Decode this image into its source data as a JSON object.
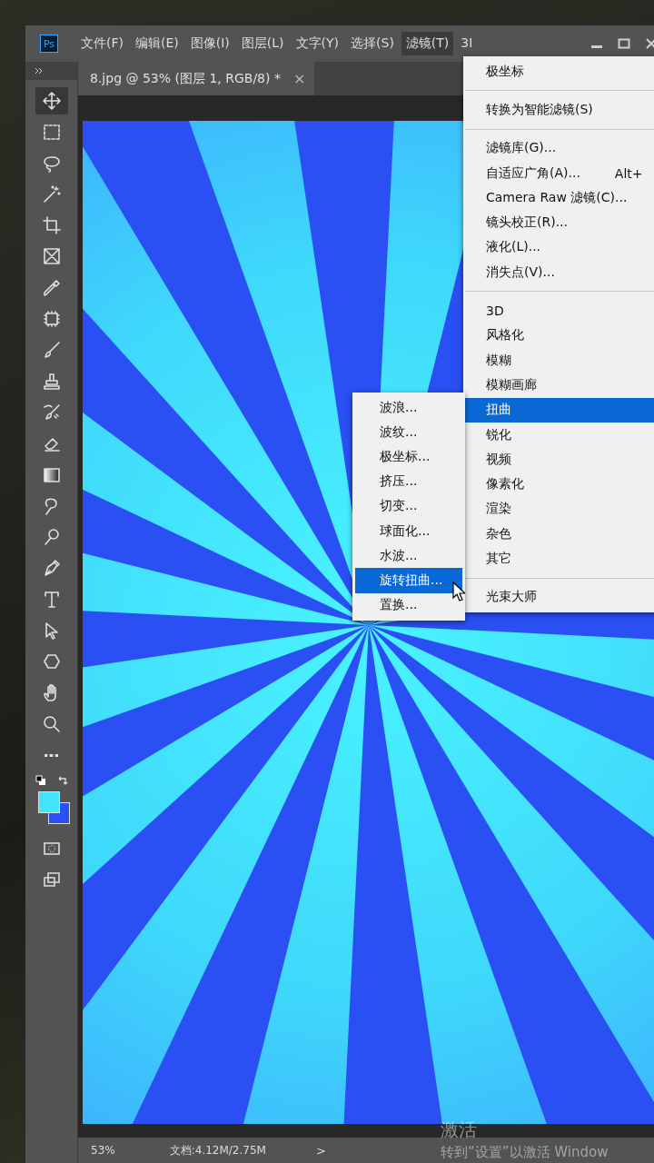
{
  "app": {
    "logo": "Ps"
  },
  "menubar": [
    {
      "label": "文件(F)",
      "selected": false
    },
    {
      "label": "编辑(E)",
      "selected": false
    },
    {
      "label": "图像(I)",
      "selected": false
    },
    {
      "label": "图层(L)",
      "selected": false
    },
    {
      "label": "文字(Y)",
      "selected": false
    },
    {
      "label": "选择(S)",
      "selected": false
    },
    {
      "label": "滤镜(T)",
      "selected": true
    },
    {
      "label": "3I",
      "selected": false
    }
  ],
  "document_tab": {
    "title": "8.jpg @ 53% (图层 1, RGB/8) *",
    "close": "×"
  },
  "tools": [
    {
      "kind": "move",
      "selected": true
    },
    {
      "kind": "marquee",
      "selected": false
    },
    {
      "kind": "lasso",
      "selected": false
    },
    {
      "kind": "wand",
      "selected": false
    },
    {
      "kind": "crop",
      "selected": false
    },
    {
      "kind": "frame",
      "selected": false
    },
    {
      "kind": "eyedropper",
      "selected": false
    },
    {
      "kind": "healing",
      "selected": false
    },
    {
      "kind": "brush",
      "selected": false
    },
    {
      "kind": "stamp",
      "selected": false
    },
    {
      "kind": "history",
      "selected": false
    },
    {
      "kind": "eraser",
      "selected": false
    },
    {
      "kind": "gradient",
      "selected": false
    },
    {
      "kind": "smudge",
      "selected": false
    },
    {
      "kind": "dodge",
      "selected": false
    },
    {
      "kind": "pen",
      "selected": false
    },
    {
      "kind": "type",
      "selected": false
    },
    {
      "kind": "pointer",
      "selected": false
    },
    {
      "kind": "shape",
      "selected": false
    },
    {
      "kind": "hand",
      "selected": false
    },
    {
      "kind": "zoom",
      "selected": false
    },
    {
      "kind": "more",
      "selected": false
    }
  ],
  "filter_menu": [
    {
      "kind": "item",
      "label": "极坐标",
      "selected": false
    },
    {
      "kind": "separator"
    },
    {
      "kind": "item",
      "label": "转换为智能滤镜(S)",
      "selected": false
    },
    {
      "kind": "separator"
    },
    {
      "kind": "item",
      "label": "滤镜库(G)...",
      "selected": false
    },
    {
      "kind": "item",
      "label": "自适应广角(A)...",
      "shortcut": "Alt+",
      "selected": false
    },
    {
      "kind": "item",
      "label": "Camera Raw 滤镜(C)...",
      "selected": false
    },
    {
      "kind": "item",
      "label": "镜头校正(R)...",
      "selected": false
    },
    {
      "kind": "item",
      "label": "液化(L)...",
      "selected": false
    },
    {
      "kind": "item",
      "label": "消失点(V)...",
      "selected": false
    },
    {
      "kind": "separator"
    },
    {
      "kind": "item",
      "label": "3D",
      "selected": false
    },
    {
      "kind": "item",
      "label": "风格化",
      "selected": false
    },
    {
      "kind": "item",
      "label": "模糊",
      "selected": false
    },
    {
      "kind": "item",
      "label": "模糊画廊",
      "selected": false
    },
    {
      "kind": "item",
      "label": "扭曲",
      "selected": true
    },
    {
      "kind": "item",
      "label": "锐化",
      "selected": false
    },
    {
      "kind": "item",
      "label": "视频",
      "selected": false
    },
    {
      "kind": "item",
      "label": "像素化",
      "selected": false
    },
    {
      "kind": "item",
      "label": "渲染",
      "selected": false
    },
    {
      "kind": "item",
      "label": "杂色",
      "selected": false
    },
    {
      "kind": "item",
      "label": "其它",
      "selected": false
    },
    {
      "kind": "separator"
    },
    {
      "kind": "item",
      "label": "光束大师",
      "selected": false
    }
  ],
  "distort_submenu": [
    {
      "label": "波浪...",
      "selected": false
    },
    {
      "label": "波纹...",
      "selected": false
    },
    {
      "label": "极坐标...",
      "selected": false
    },
    {
      "label": "挤压...",
      "selected": false
    },
    {
      "label": "切变...",
      "selected": false
    },
    {
      "label": "球面化...",
      "selected": false
    },
    {
      "label": "水波...",
      "selected": false
    },
    {
      "label": "旋转扭曲...",
      "selected": true
    },
    {
      "label": "置换...",
      "selected": false
    }
  ],
  "status_bar": {
    "zoom": "53%",
    "document": "文档:4.12M/2.75M",
    "arrow": ">"
  },
  "activation_notice": {
    "title": "激活",
    "hint": "转到“设置”以激活 Window"
  }
}
